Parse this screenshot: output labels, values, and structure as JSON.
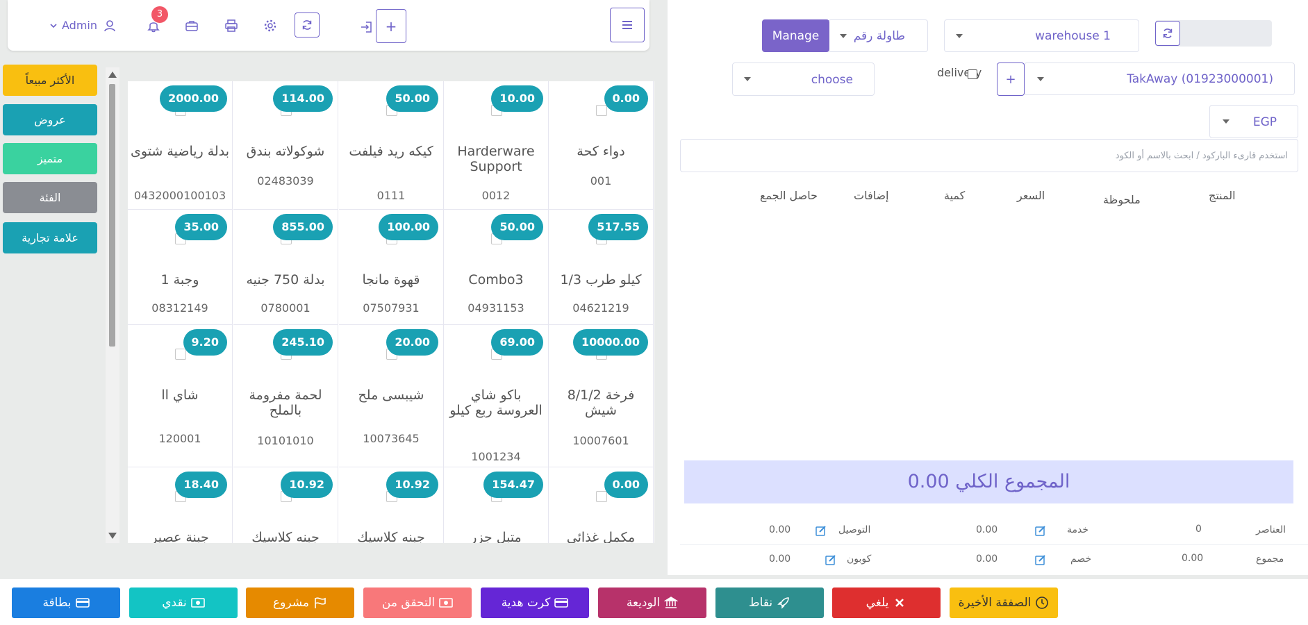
{
  "header": {
    "notifications_count": "3",
    "user_label": "Admin",
    "plus_label": "+"
  },
  "categories": [
    {
      "label": "الأكثر مبيعاً",
      "color": "#f9bf10",
      "text_color": "#333333"
    },
    {
      "label": "عروض",
      "color": "#1aa1b3",
      "text_color": "#ffffff"
    },
    {
      "label": "متميز",
      "color": "#3ad29f",
      "text_color": "#ffffff"
    },
    {
      "label": "الفئة",
      "color": "#8a8d93",
      "text_color": "#ffffff"
    },
    {
      "label": "علامة تجارية",
      "color": "#1aa1b3",
      "text_color": "#ffffff"
    }
  ],
  "products": [
    {
      "price": "0.00",
      "name": "دواء كحة",
      "code": "001"
    },
    {
      "price": "10.00",
      "name": "Harderware Support",
      "code": "0012"
    },
    {
      "price": "50.00",
      "name": "كيكه ريد فيلفت",
      "code": "0111"
    },
    {
      "price": "114.00",
      "name": "شوكولاته بندق",
      "code": "02483039"
    },
    {
      "price": "2000.00",
      "name": "بدلة رياضية شتوى",
      "code": "0432000100103"
    },
    {
      "price": "517.55",
      "name": "1/3 كيلو طرب",
      "code": "04621219"
    },
    {
      "price": "50.00",
      "name": "Combo3",
      "code": "04931153"
    },
    {
      "price": "100.00",
      "name": "قهوة مانجا",
      "code": "07507931"
    },
    {
      "price": "855.00",
      "name": "بدلة 750 جنيه",
      "code": "0780001"
    },
    {
      "price": "35.00",
      "name": "وجبة 1",
      "code": "08312149"
    },
    {
      "price": "10000.00",
      "name": "8/1/2 فرخة شيش",
      "code": "10007601"
    },
    {
      "price": "69.00",
      "name": "باكو شاي العروسة ربع كيلو",
      "code": "1001234"
    },
    {
      "price": "20.00",
      "name": "شيبسى ملح",
      "code": "10073645"
    },
    {
      "price": "245.10",
      "name": "لحمة مفرومة بالملح",
      "code": "10101010"
    },
    {
      "price": "9.20",
      "name": "شاي اا",
      "code": "120001"
    },
    {
      "price": "0.00",
      "name": "مكمل غذائي",
      "code": ""
    },
    {
      "price": "154.47",
      "name": "متبل جزر",
      "code": ""
    },
    {
      "price": "10.92",
      "name": "جبنه كلاسيك",
      "code": ""
    },
    {
      "price": "10.92",
      "name": "جبنه كلاسيك",
      "code": ""
    },
    {
      "price": "18.40",
      "name": "جبنة عصير",
      "code": ""
    }
  ],
  "order": {
    "warehouse": "warehouse 1",
    "table": "طاولة رقم",
    "manage_label": "Manage",
    "customer": "TakAway (01923000001)",
    "add_label": "+",
    "delivery_label": "delivery",
    "choose": "choose",
    "currency": "EGP",
    "search_placeholder": "استخدم قارىء الباركود / ابحث بالاسم أو الكود",
    "columns": {
      "product": "المنتج",
      "note": "ملحوظة",
      "price": "السعر",
      "qty": "كمية",
      "extras": "إضافات",
      "subtotal": "حاصل الجمع"
    },
    "grand_total": "المجموع الكلي 0.00",
    "items_label": "العناصر",
    "items_value": "0",
    "service_label": "خدمة",
    "service_value": "0.00",
    "delivery_fee_label": "التوصيل",
    "delivery_fee_value": "0.00",
    "total_label": "مجموع",
    "total_value": "0.00",
    "discount_label": "خصم",
    "discount_value": "0.00",
    "coupon_label": "كوبون",
    "coupon_value": "0.00"
  },
  "actions": [
    {
      "label": "بطاقة",
      "color": "#1a7ee0",
      "icon": "credit-card-icon"
    },
    {
      "label": "نقدي",
      "color": "#13c4c4",
      "icon": "money-icon"
    },
    {
      "label": "مشروع",
      "color": "#e68a00",
      "icon": "flag-icon"
    },
    {
      "label": "التحقق من",
      "color": "#f8787a",
      "icon": "money-icon"
    },
    {
      "label": "كرت هدية",
      "color": "#6526d6",
      "icon": "credit-card-icon"
    },
    {
      "label": "الوديعة",
      "color": "#b7326a",
      "icon": "bank-icon"
    },
    {
      "label": "نقاط",
      "color": "#2e8f8f",
      "icon": "rocket-icon"
    },
    {
      "label": "يلغي",
      "color": "#de2f2f",
      "icon": "close-icon"
    },
    {
      "label": "الصفقة الأخيرة",
      "color": "#f9bf10",
      "icon": "clock-icon"
    }
  ]
}
